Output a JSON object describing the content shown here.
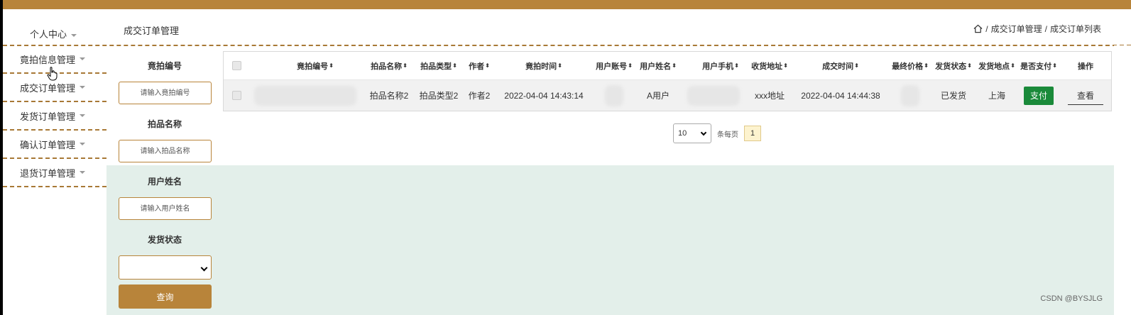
{
  "sidebar": {
    "user_center": "个人中心",
    "items": [
      {
        "label": "竟拍信息管理"
      },
      {
        "label": "成交订单管理"
      },
      {
        "label": "发货订单管理"
      },
      {
        "label": "确认订单管理"
      },
      {
        "label": "退货订单管理"
      }
    ]
  },
  "header": {
    "page_title": "成交订单管理",
    "breadcrumb": [
      "成交订单管理",
      "成交订单列表"
    ],
    "breadcrumb_sep": "/"
  },
  "search": {
    "label1": "竟拍编号",
    "placeholder1": "请输入竟拍编号",
    "label2": "拍品名称",
    "placeholder2": "请输入拍品名称",
    "label3": "用户姓名",
    "placeholder3": "请输入用户姓名",
    "label4": "发货状态",
    "select_value": "",
    "button": "查询"
  },
  "table": {
    "columns": [
      "竟拍编号",
      "拍品名称",
      "拍品类型",
      "作者",
      "竟拍时间",
      "用户账号",
      "用户姓名",
      "用户手机",
      "收货地址",
      "成交时间",
      "最终价格",
      "发货状态",
      "发货地点",
      "是否支付",
      "操作"
    ],
    "sort_glyph": "⬍",
    "rows": [
      {
        "item_name": "拍品名称2",
        "item_type": "拍品类型2",
        "author": "作者2",
        "bid_time": "2022-04-04 14:43:14",
        "user_name": "A用户",
        "address": "xxx地址",
        "deal_time": "2022-04-04 14:44:38",
        "ship_status": "已发货",
        "ship_place": "上海",
        "pay_label": "支付",
        "view_label": "查看"
      }
    ]
  },
  "pager": {
    "page_size": "10",
    "per_page_label": "条每页",
    "current_page": "1"
  },
  "watermark": "CSDN @BYSJLG",
  "colors": {
    "accent": "#b8843a",
    "pay_green": "#1a8a3a",
    "content_bg": "#e3efea"
  }
}
